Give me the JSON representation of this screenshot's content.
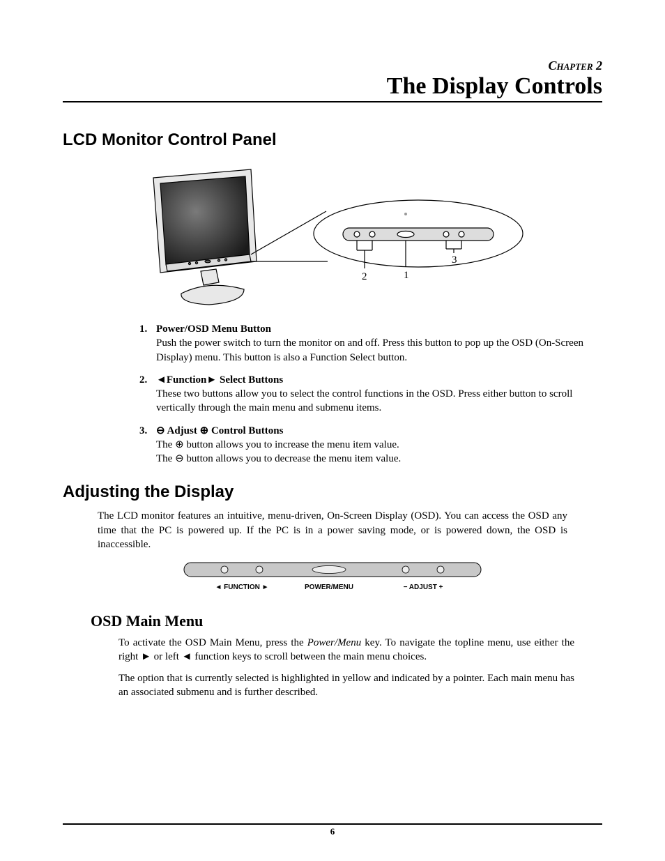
{
  "chapter_label": "Chapter 2",
  "title": "The Display Controls",
  "section1": "LCD Monitor Control Panel",
  "diagram_labels": {
    "a": "1",
    "b": "2",
    "c": "3"
  },
  "items": [
    {
      "num": "1.",
      "label": "Power/OSD Menu Button",
      "text": "Push the power switch to turn the monitor on and off.  Press this button to pop up the OSD (On-Screen Display) menu. This button is also a Function Select button."
    },
    {
      "num": "2.",
      "label_pre": "◄",
      "label_mid": "Function",
      "label_post": "►",
      "label_tail": "Select Buttons",
      "text": "These two buttons allow you to select the control functions in the OSD.  Press either button to scroll vertically through the main menu and submenu items."
    },
    {
      "num": "3.",
      "label_pre": "⊖",
      "label_mid": " Adjust ",
      "label_post": "⊕",
      "label_tail": " Control Buttons",
      "line1_a": "The ",
      "line1_sym": "⊕",
      "line1_b": " button allows you to increase the menu item value.",
      "line2_a": "The ",
      "line2_sym": "⊖",
      "line2_b": " button allows you to decrease the menu item value."
    }
  ],
  "section2": "Adjusting the Display",
  "para1": "The LCD monitor features an intuitive, menu-driven, On-Screen Display (OSD). You can access the OSD any time that the PC is powered up. If the PC is in a power saving mode, or is powered down, the OSD is inaccessible.",
  "strip": {
    "function": "◄ FUNCTION ►",
    "power": "POWER/MENU",
    "adjust": "− ADJUST +"
  },
  "subsection": "OSD Main Menu",
  "para2_a": "To activate the OSD Main Menu, press the ",
  "para2_em": "Power/Menu",
  "para2_b": " key. To navigate the topline menu, use either the right ► or left ◄ function keys to scroll between the main menu choices.",
  "para3": "The option that is currently selected is highlighted in yellow and indicated by a pointer.  Each main menu has an associated submenu and is further described.",
  "page_number": "6"
}
